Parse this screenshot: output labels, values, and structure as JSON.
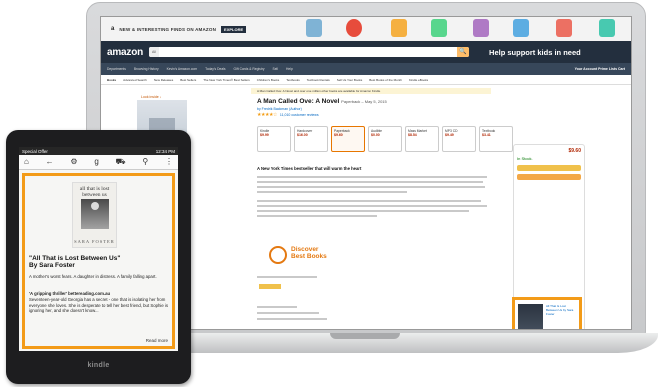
{
  "amazon": {
    "strip_promo": "NEW & INTERESTING FINDS ON AMAZON",
    "explore_label": "EXPLORE",
    "logo_text": "amazon",
    "search_category": "All",
    "search_go": "🔍",
    "help_kids": "Help support kids in need",
    "nav_items": [
      "Departments",
      "Browsing History",
      "Kevin's Amazon.com",
      "Today's Deals",
      "Gift Cards & Registry",
      "Sell",
      "Help"
    ],
    "nav_right": "Your Account  Prime  Lists  Cart",
    "categories": [
      "Books",
      "Advanced Search",
      "New Releases",
      "Best Sellers",
      "The New York Times® Best Sellers",
      "Children's Books",
      "Textbooks",
      "Textbook Rentals",
      "Sell Us Your Books",
      "Best Books of the Month",
      "Kindle eBooks"
    ],
    "notice": "A Man Called Ove: A Novel and over one million other books are available for Amazon Kindle",
    "look_inside": "Look inside ↓",
    "product_title": "A Man Called Ove: A Novel",
    "product_format": "Paperback – May 5, 2015",
    "product_author": "by Fredrik Backman (Author)",
    "stars": "★★★★☆",
    "reviews": "11,010 customer reviews",
    "formats": [
      {
        "name": "Kindle",
        "price": "$9.99"
      },
      {
        "name": "Hardcover",
        "price": "$16.00"
      },
      {
        "name": "Paperback",
        "price": "$9.60"
      },
      {
        "name": "Audible",
        "price": "$0.00"
      },
      {
        "name": "Mass Market",
        "price": "$8.54"
      },
      {
        "name": "MP3 CD",
        "price": "$9.49"
      },
      {
        "name": "Textbook",
        "price": "$3.41"
      }
    ],
    "desc_head": "A New York Times bestseller that will warm the heart",
    "discover_line1": "Discover",
    "discover_line2": "Best Books",
    "buy_price": "$9.60",
    "in_stock": "In Stock.",
    "ad_text": "All That Is Lost Between Us by Sara Foster"
  },
  "kindle": {
    "status_left": "Special Offer",
    "status_time": "12:34 PM",
    "cover_title": "all that is lost between us",
    "cover_author": "SARA FOSTER",
    "book_title": "\"All That is Lost Between Us\"",
    "book_author": "By Sara Foster",
    "para1": "A mother's worst fears. A daughter in distress. A family falling apart.",
    "para2_head": "'A gripping thriller' bettereading.com.au",
    "para2": "Seventeen-year-old Georgia has a secret - one that is isolating her from everyone she loves. She is desperate to tell her best friend, but Sophie is ignoring her, and she doesn't know...",
    "read_more": "Read more",
    "brand": "kindle"
  }
}
